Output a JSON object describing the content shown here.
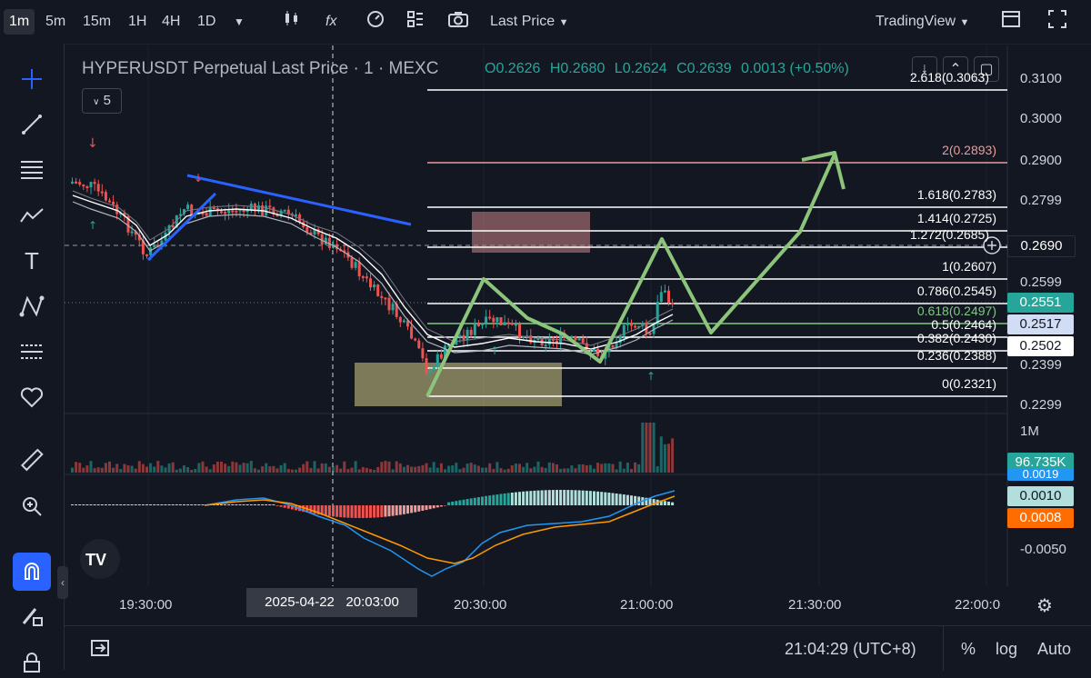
{
  "toolbar": {
    "intervals": [
      "1m",
      "5m",
      "15m",
      "1H",
      "4H",
      "1D"
    ],
    "active_interval": "1m",
    "price_type": "Last Price",
    "brand": "TradingView"
  },
  "legend": {
    "symbol": "HYPERUSDT Perpetual Last Price · 1 · MEXC",
    "o_label": "O",
    "o": "0.2626",
    "h_label": "H",
    "h": "0.2680",
    "l_label": "L",
    "l": "0.2624",
    "c_label": "C",
    "c": "0.2639",
    "change": "0.0013 (+0.50%)",
    "indicator_count": "5"
  },
  "price_axis": [
    "0.3100",
    "0.3000",
    "0.2900",
    "0.2799",
    "0.2599",
    "0.2399",
    "0.2299"
  ],
  "price_badges": {
    "last": "0.2690",
    "green": "0.2551",
    "blue": "0.2517",
    "white": "0.2502"
  },
  "volume_axis": "1M",
  "volume_badge": "96.735K",
  "macd_axis": "-0.0050",
  "macd_badges": {
    "a": "0.0019",
    "b": "0.0010",
    "c": "0.0008"
  },
  "fib_levels": [
    {
      "label": "2.618(0.3063)"
    },
    {
      "label": "2(0.2893)"
    },
    {
      "label": "1.618(0.2783)"
    },
    {
      "label": "1.414(0.2725)"
    },
    {
      "label": "1.272(0.2685)"
    },
    {
      "label": "1(0.2607)"
    },
    {
      "label": "0.786(0.2545)"
    },
    {
      "label": "0.618(0.2497)"
    },
    {
      "label": "0.5(0.2464)"
    },
    {
      "label": "0.382(0.2430)"
    },
    {
      "label": "0.236(0.2388)"
    },
    {
      "label": "0(0.2321)"
    }
  ],
  "time_axis": [
    "19:30:00",
    "20:30:00",
    "21:00:00",
    "21:30:00",
    "22:00:0"
  ],
  "crosshair_time": {
    "date": "2025-04-22",
    "time": "20:03:00"
  },
  "clock": "21:04:29 (UTC+8)",
  "bottom": {
    "percent": "%",
    "log": "log",
    "auto": "Auto"
  },
  "colors": {
    "up": "#26a69a",
    "down": "#ef5350",
    "bg": "#131722",
    "trend": "#2962ff",
    "arrow": "#8bc47a"
  },
  "icons": [
    "crosshair-icon",
    "trendline-icon",
    "fib-icon",
    "pattern-icon",
    "text-icon",
    "node-icon",
    "forecast-icon",
    "heart-icon",
    "ruler-icon",
    "zoom-icon",
    "magnet-icon",
    "pencil-lock-icon",
    "lock-icon"
  ]
}
